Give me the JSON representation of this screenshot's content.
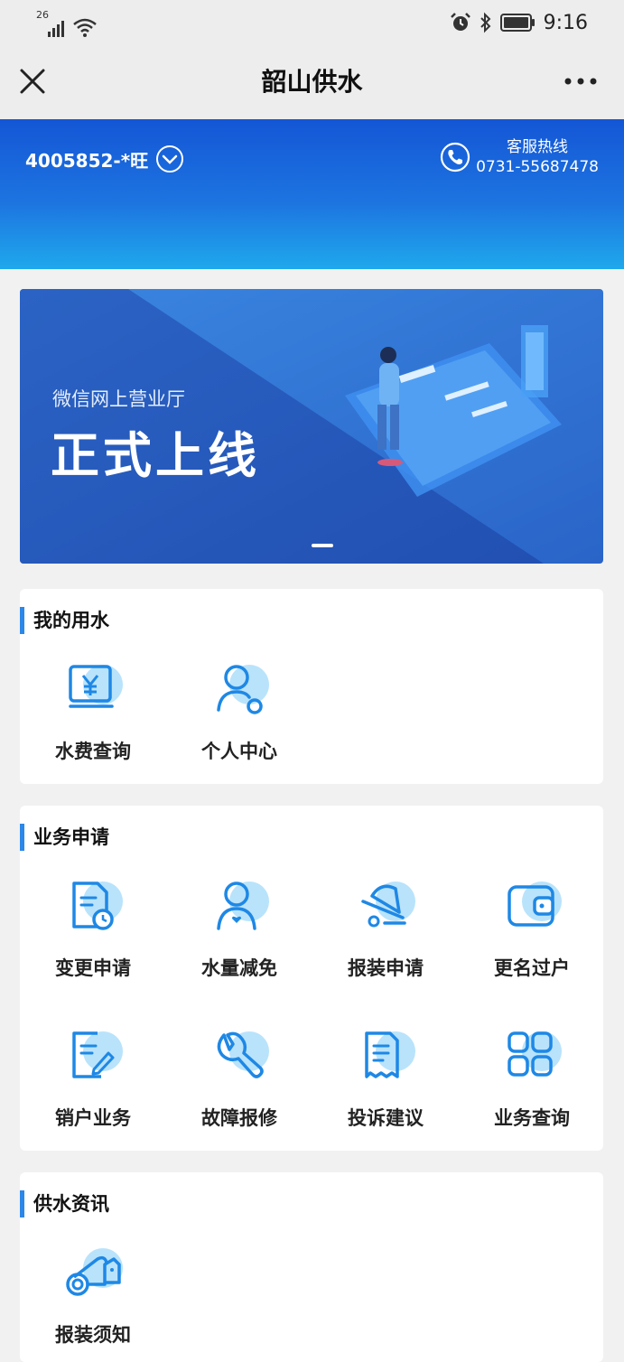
{
  "status_bar": {
    "network": "26",
    "time": "9:16"
  },
  "nav": {
    "title": "韶山供水"
  },
  "header": {
    "account": "4005852-*旺",
    "hotline_title": "客服热线",
    "hotline_number": "0731-55687478"
  },
  "banner": {
    "subtitle": "微信网上营业厅",
    "title": "正式上线"
  },
  "sections": {
    "my_water": {
      "title": "我的用水",
      "items": [
        {
          "label": "水费查询",
          "icon": "bill-icon"
        },
        {
          "label": "个人中心",
          "icon": "user-icon"
        }
      ]
    },
    "business": {
      "title": "业务申请",
      "items": [
        {
          "label": "变更申请",
          "icon": "doc-clock-icon"
        },
        {
          "label": "水量减免",
          "icon": "user-heart-icon"
        },
        {
          "label": "报装申请",
          "icon": "bell-icon"
        },
        {
          "label": "更名过户",
          "icon": "wallet-icon"
        },
        {
          "label": "销户业务",
          "icon": "edit-doc-icon"
        },
        {
          "label": "故障报修",
          "icon": "wrench-icon"
        },
        {
          "label": "投诉建议",
          "icon": "receipt-icon"
        },
        {
          "label": "业务查询",
          "icon": "grid-icon"
        }
      ]
    },
    "news": {
      "title": "供水资讯",
      "items": [
        {
          "label": "报装须知",
          "icon": "pipe-icon"
        }
      ]
    }
  },
  "colors": {
    "accent": "#2b87e8",
    "icon_blue": "#1e88e5",
    "icon_bubble": "#b9e3fb"
  }
}
